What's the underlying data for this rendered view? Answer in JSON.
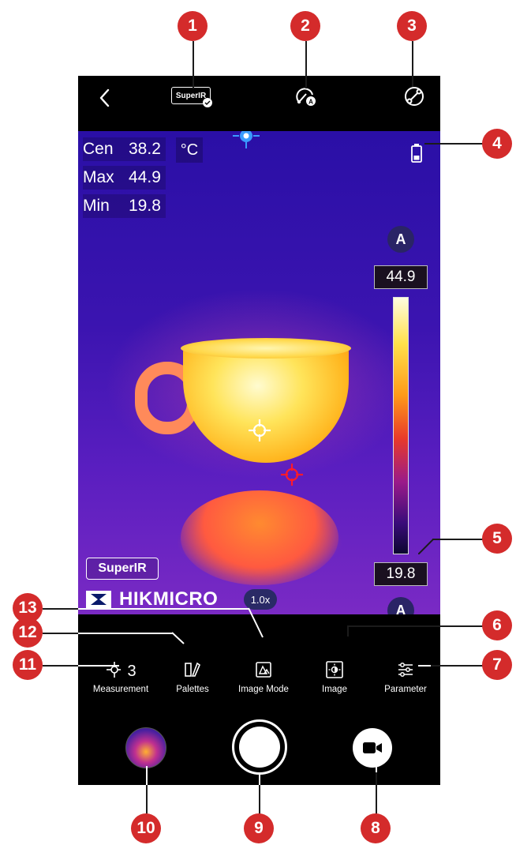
{
  "status_bar": {
    "back_icon": "chevron-left-icon",
    "superir_label": "SuperIR"
  },
  "readout": {
    "cen_label": "Cen",
    "cen_value": "38.2",
    "max_label": "Max",
    "max_value": "44.9",
    "min_label": "Min",
    "min_value": "19.8",
    "unit": "°C"
  },
  "scale": {
    "max": "44.9",
    "min": "19.8",
    "auto_top": "A",
    "auto_bottom": "A"
  },
  "overlay": {
    "superir_badge": "SuperIR",
    "brand": "HIKMICRO",
    "zoom": "1.0x"
  },
  "toolbar": [
    {
      "label": "Measurement",
      "icon": "measurement-icon",
      "icon_text": "3"
    },
    {
      "label": "Palettes",
      "icon": "palettes-icon"
    },
    {
      "label": "Image Mode",
      "icon": "image-mode-icon"
    },
    {
      "label": "Image",
      "icon": "image-icon"
    },
    {
      "label": "Parameter",
      "icon": "parameter-icon"
    }
  ],
  "callouts": [
    "1",
    "2",
    "3",
    "4",
    "5",
    "6",
    "7",
    "8",
    "9",
    "10",
    "11",
    "12",
    "13"
  ],
  "colors": {
    "callout": "#d42b2b",
    "screen_bg": "#000000",
    "spot_center": "#ffffff",
    "spot_max": "#ff1a2a"
  }
}
